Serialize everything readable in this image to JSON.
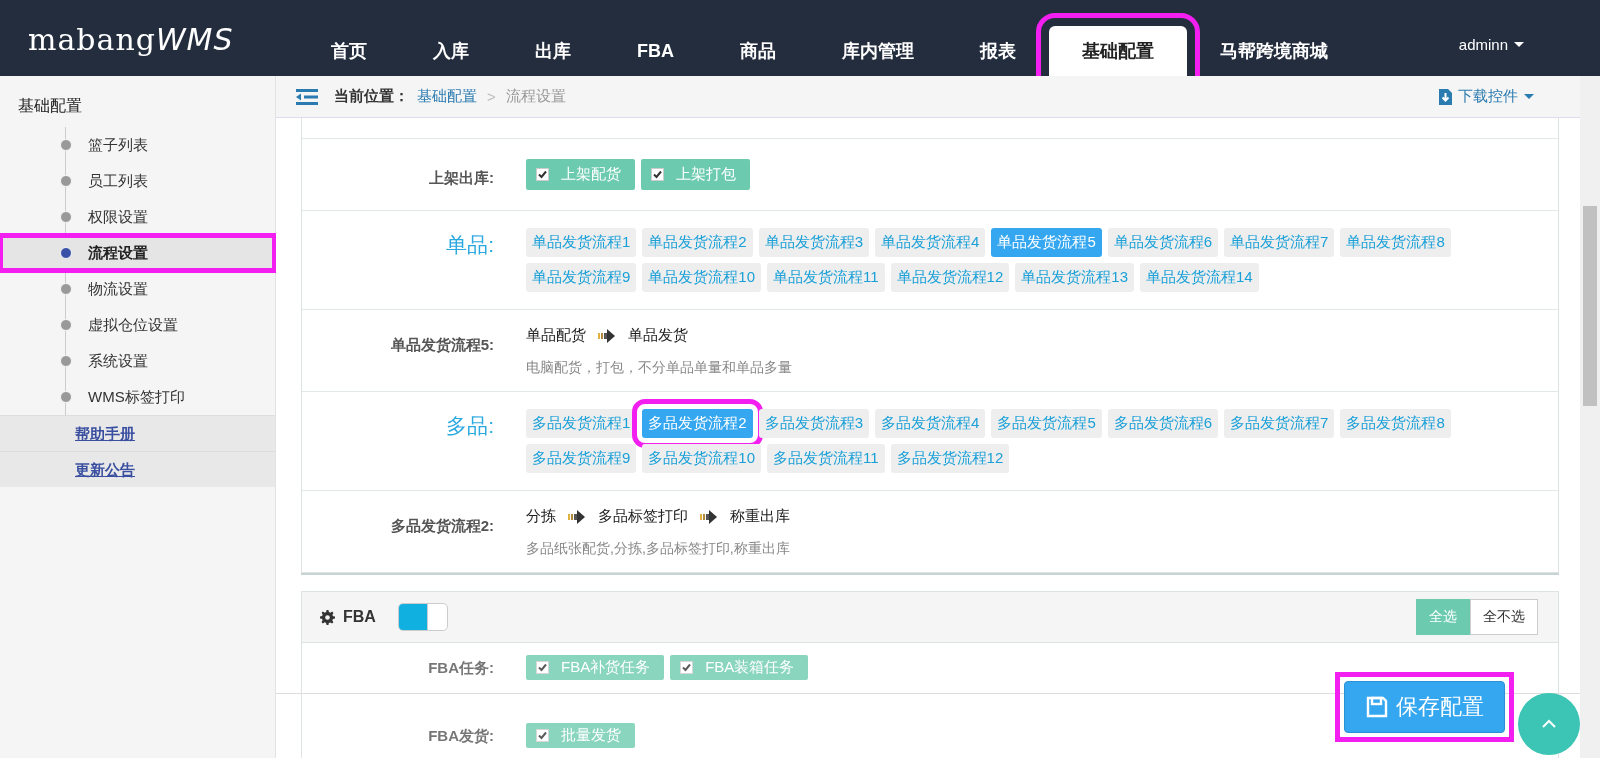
{
  "header": {
    "logo": "mabang",
    "logo_accent": "WMS",
    "nav": [
      {
        "label": "首页",
        "selected": false,
        "highlighted": false
      },
      {
        "label": "入库",
        "selected": false,
        "highlighted": false
      },
      {
        "label": "出库",
        "selected": false,
        "highlighted": false
      },
      {
        "label": "FBA",
        "selected": false,
        "highlighted": false
      },
      {
        "label": "商品",
        "selected": false,
        "highlighted": false
      },
      {
        "label": "库内管理",
        "selected": false,
        "highlighted": false
      },
      {
        "label": "报表",
        "selected": false,
        "highlighted": false
      },
      {
        "label": "基础配置",
        "selected": true,
        "highlighted": true
      },
      {
        "label": "马帮跨境商城",
        "selected": false,
        "highlighted": false
      }
    ],
    "user": "adminn"
  },
  "sidebar": {
    "title": "基础配置",
    "items": [
      {
        "label": "篮子列表",
        "selected": false,
        "highlighted": false
      },
      {
        "label": "员工列表",
        "selected": false,
        "highlighted": false
      },
      {
        "label": "权限设置",
        "selected": false,
        "highlighted": false
      },
      {
        "label": "流程设置",
        "selected": true,
        "highlighted": true
      },
      {
        "label": "物流设置",
        "selected": false,
        "highlighted": false
      },
      {
        "label": "虚拟仓位设置",
        "selected": false,
        "highlighted": false
      },
      {
        "label": "系统设置",
        "selected": false,
        "highlighted": false
      },
      {
        "label": "WMS标签打印",
        "selected": false,
        "highlighted": false
      }
    ],
    "links": [
      "帮助手册",
      "更新公告"
    ]
  },
  "breadcrumb": {
    "prefix": "当前位置：",
    "items": [
      "基础配置",
      "流程设置"
    ],
    "separator": ">",
    "download": "下载控件"
  },
  "rows": [
    {
      "kind": "checks",
      "label": "上架出库:",
      "options": [
        {
          "label": "上架配货",
          "checked": true
        },
        {
          "label": "上架打包",
          "checked": true
        }
      ]
    },
    {
      "kind": "flows",
      "label": "单品:",
      "options": [
        {
          "label": "单品发货流程1",
          "selected": false,
          "highlighted": false
        },
        {
          "label": "单品发货流程2",
          "selected": false,
          "highlighted": false
        },
        {
          "label": "单品发货流程3",
          "selected": false,
          "highlighted": false
        },
        {
          "label": "单品发货流程4",
          "selected": false,
          "highlighted": false
        },
        {
          "label": "单品发货流程5",
          "selected": true,
          "highlighted": false
        },
        {
          "label": "单品发货流程6",
          "selected": false,
          "highlighted": false
        },
        {
          "label": "单品发货流程7",
          "selected": false,
          "highlighted": false
        },
        {
          "label": "单品发货流程8",
          "selected": false,
          "highlighted": false
        },
        {
          "label": "单品发货流程9",
          "selected": false,
          "highlighted": false
        },
        {
          "label": "单品发货流程10",
          "selected": false,
          "highlighted": false
        },
        {
          "label": "单品发货流程11",
          "selected": false,
          "highlighted": false
        },
        {
          "label": "单品发货流程12",
          "selected": false,
          "highlighted": false
        },
        {
          "label": "单品发货流程13",
          "selected": false,
          "highlighted": false
        },
        {
          "label": "单品发货流程14",
          "selected": false,
          "highlighted": false
        }
      ]
    },
    {
      "kind": "steps",
      "label": "单品发货流程5:",
      "steps": [
        "单品配货",
        "单品发货"
      ],
      "description": "电脑配货，打包，不分单品单量和单品多量"
    },
    {
      "kind": "flows",
      "label": "多品:",
      "options": [
        {
          "label": "多品发货流程1",
          "selected": false,
          "highlighted": false
        },
        {
          "label": "多品发货流程2",
          "selected": true,
          "highlighted": true
        },
        {
          "label": "多品发货流程3",
          "selected": false,
          "highlighted": false
        },
        {
          "label": "多品发货流程4",
          "selected": false,
          "highlighted": false
        },
        {
          "label": "多品发货流程5",
          "selected": false,
          "highlighted": false
        },
        {
          "label": "多品发货流程6",
          "selected": false,
          "highlighted": false
        },
        {
          "label": "多品发货流程7",
          "selected": false,
          "highlighted": false
        },
        {
          "label": "多品发货流程8",
          "selected": false,
          "highlighted": false
        },
        {
          "label": "多品发货流程9",
          "selected": false,
          "highlighted": false
        },
        {
          "label": "多品发货流程10",
          "selected": false,
          "highlighted": false
        },
        {
          "label": "多品发货流程11",
          "selected": false,
          "highlighted": false
        },
        {
          "label": "多品发货流程12",
          "selected": false,
          "highlighted": false
        }
      ]
    },
    {
      "kind": "steps",
      "label": "多品发货流程2:",
      "steps": [
        "分拣",
        "多品标签打印",
        "称重出库"
      ],
      "description": "多品纸张配货,分拣,多品标签打印,称重出库"
    }
  ],
  "fba": {
    "title": "FBA",
    "on": true,
    "buttons": [
      {
        "label": "全选",
        "selected": true
      },
      {
        "label": "全不选",
        "selected": false
      }
    ],
    "rows": [
      {
        "kind": "checks",
        "label": "FBA任务:",
        "options": [
          {
            "label": "FBA补货任务",
            "checked": true
          },
          {
            "label": "FBA装箱任务",
            "checked": true
          }
        ]
      },
      {
        "kind": "checks",
        "label": "FBA发货:",
        "options": [
          {
            "label": "批量发货",
            "checked": true
          }
        ]
      }
    ]
  },
  "save_button": {
    "label": "保存配置",
    "highlighted": true
  }
}
